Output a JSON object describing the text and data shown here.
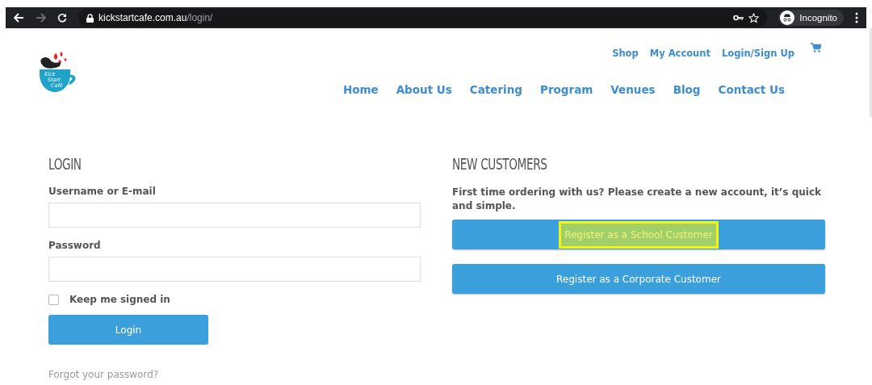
{
  "browser": {
    "url_domain": "kickstartcafe.com.au",
    "url_path": "/login/",
    "profile": "Incognito",
    "forward_disabled": true
  },
  "logo": {
    "lines": [
      "Kick",
      "Start",
      "Café"
    ]
  },
  "top_links": [
    "Shop",
    "My Account",
    "Login/Sign Up"
  ],
  "nav": [
    "Home",
    "About Us",
    "Catering",
    "Program",
    "Venues",
    "Blog",
    "Contact Us"
  ],
  "login": {
    "heading": "LOGIN",
    "fields": [
      {
        "label": "Username or E-mail"
      },
      {
        "label": "Password"
      }
    ],
    "remember": {
      "label": "Keep me signed in",
      "checked": false
    },
    "button": "Login",
    "forgot": "Forgot your password?"
  },
  "new_customers": {
    "heading": "NEW CUSTOMERS",
    "text": "First time ordering with us? Please create a new account, it’s quick and simple.",
    "buttons": [
      {
        "label": "Register as a School Customer",
        "highlighted": true
      },
      {
        "label": "Register as a Corporate Customer",
        "highlighted": false
      }
    ]
  }
}
